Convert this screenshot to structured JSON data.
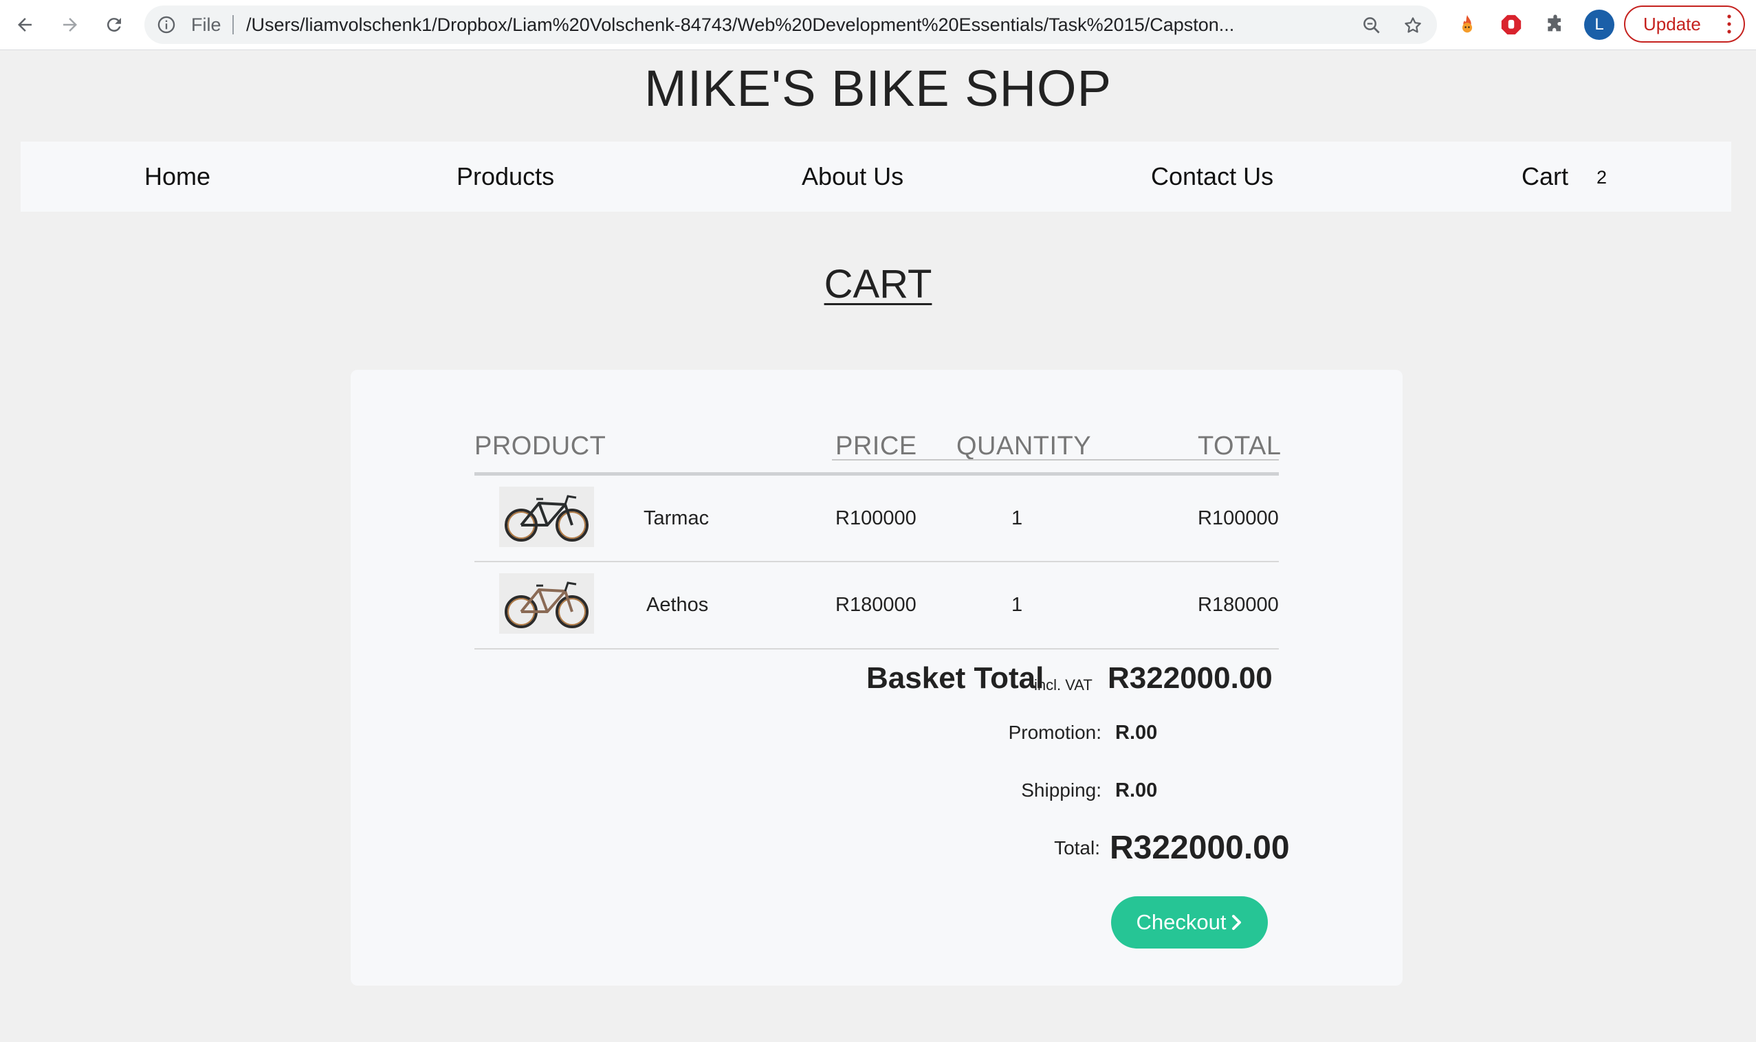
{
  "browser": {
    "file_label": "File",
    "url": "/Users/liamvolschenk1/Dropbox/Liam%20Volschenk-84743/Web%20Development%20Essentials/Task%2015/Capston...",
    "profile_initial": "L",
    "update_label": "Update"
  },
  "site": {
    "title": "MIKE'S BIKE SHOP",
    "nav": {
      "home": "Home",
      "products": "Products",
      "about": "About Us",
      "contact": "Contact Us",
      "cart": "Cart",
      "cart_count": "2"
    }
  },
  "cart": {
    "heading": "CART",
    "columns": {
      "product": "PRODUCT",
      "price": "PRICE",
      "quantity": "QUANTITY",
      "total": "TOTAL"
    },
    "items": [
      {
        "name": "Tarmac",
        "price": "R100000",
        "quantity": "1",
        "total": "R100000",
        "frame_color": "#2a2d2e"
      },
      {
        "name": "Aethos",
        "price": "R180000",
        "quantity": "1",
        "total": "R180000",
        "frame_color": "#8a6a55"
      }
    ],
    "basket_total_label": "Basket Total",
    "basket_total_sub": "incl. VAT",
    "basket_total_value": "R322000.00",
    "promotion_label": "Promotion:",
    "promotion_value": "R.00",
    "shipping_label": "Shipping:",
    "shipping_value": "R.00",
    "total_label": "Total:",
    "total_value": "R322000.00",
    "checkout_label": "Checkout"
  },
  "colors": {
    "accent": "#26c595",
    "update": "#c5221f"
  }
}
